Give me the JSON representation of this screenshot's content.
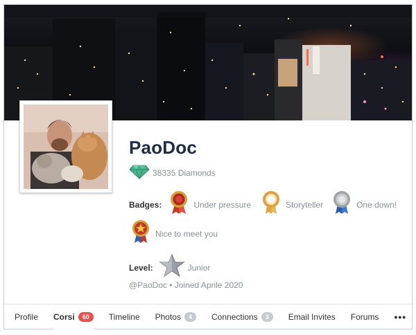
{
  "profile": {
    "name": "PaoDoc",
    "diamonds_text": "38335 Diamonds",
    "badges_label": "Badges:",
    "badges": [
      {
        "name": "Under pressure",
        "icon": "medal-red-icon"
      },
      {
        "name": "Storyteller",
        "icon": "medal-gold-ring-icon"
      },
      {
        "name": "One down!",
        "icon": "medal-silver-icon"
      },
      {
        "name": "Nice to meet you",
        "icon": "medal-star-icon"
      }
    ],
    "level_label": "Level:",
    "level_value": "Junior",
    "meta": "@PaoDoc • Joined Aprile 2020"
  },
  "tabs": [
    {
      "label": "Profile"
    },
    {
      "label": "Corsi",
      "count": "60"
    },
    {
      "label": "Timeline"
    },
    {
      "label": "Photos",
      "count": "4"
    },
    {
      "label": "Connections",
      "count": "3"
    },
    {
      "label": "Email Invites"
    },
    {
      "label": "Forums"
    },
    {
      "label": "•••"
    }
  ],
  "colors": {
    "name": "#1d2d44",
    "badge_count_red": "#e4514f",
    "badge_count_grey": "#c7cbcf",
    "diamond": "#3aa380"
  }
}
